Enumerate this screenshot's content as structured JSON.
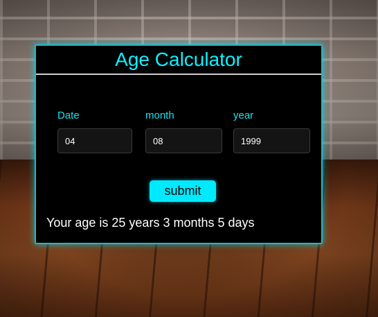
{
  "colors": {
    "accent": "#00eaff",
    "card_background": "#000000",
    "label_color": "#11e4f5"
  },
  "calculator": {
    "title": "Age Calculator",
    "fields": {
      "date": {
        "label": "Date",
        "value": "04"
      },
      "month": {
        "label": "month",
        "value": "08"
      },
      "year": {
        "label": "year",
        "value": "1999"
      }
    },
    "submit_label": "submit",
    "result": "Your age is 25 years 3 months 5 days"
  }
}
